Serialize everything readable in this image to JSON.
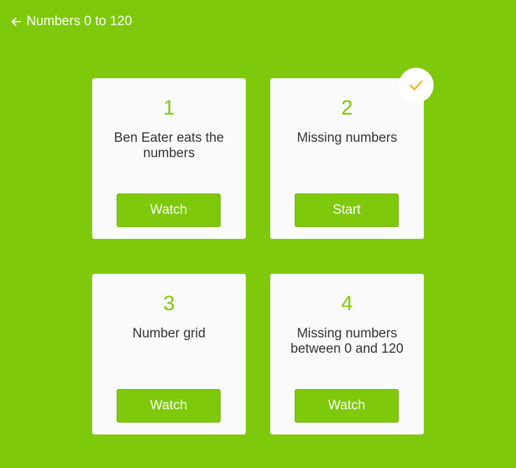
{
  "header": {
    "back_icon": "arrow-left-icon",
    "title": "Numbers 0 to 120"
  },
  "colors": {
    "background": "#7ec90b",
    "card": "#fafafa",
    "accent": "#7ec90b",
    "text": "#333333",
    "check": "#f5b82e"
  },
  "cards": [
    {
      "number": "1",
      "title": "Ben Eater eats the numbers",
      "button": "Watch",
      "completed": false
    },
    {
      "number": "2",
      "title": "Missing numbers",
      "button": "Start",
      "completed": true
    },
    {
      "number": "3",
      "title": "Number grid",
      "button": "Watch",
      "completed": false
    },
    {
      "number": "4",
      "title": "Missing numbers between 0 and 120",
      "button": "Watch",
      "completed": false
    }
  ],
  "completed_badge_icon": "checkmark-icon"
}
